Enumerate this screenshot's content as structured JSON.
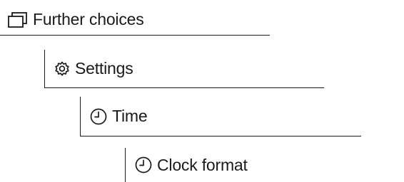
{
  "hierarchy": [
    {
      "label": "Further choices",
      "icon": "windows-icon"
    },
    {
      "label": "Settings",
      "icon": "gear-icon"
    },
    {
      "label": "Time",
      "icon": "clock-icon"
    },
    {
      "label": "Clock format",
      "icon": "clock-icon"
    }
  ]
}
